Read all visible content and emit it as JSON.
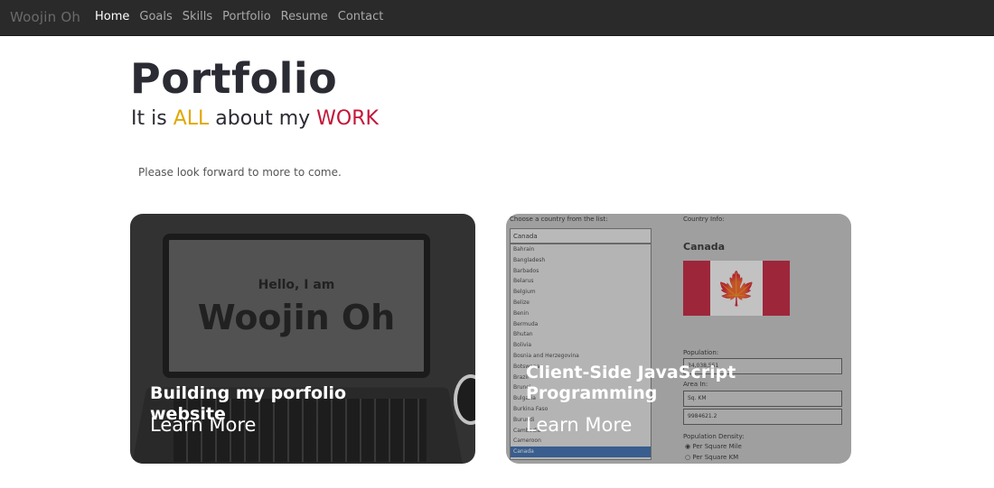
{
  "navbar": {
    "brand": "Woojin Oh",
    "links": [
      "Home",
      "Goals",
      "Skills",
      "Portfolio",
      "Resume",
      "Contact"
    ]
  },
  "header": {
    "title": "Portfolio",
    "tagline_part1": "It is ",
    "tagline_all": "ALL",
    "tagline_part2": " about my ",
    "tagline_work": "WORK",
    "intro": "Please look forward to more to come."
  },
  "cards": [
    {
      "title": "Building my porfolio website",
      "link": "Learn More",
      "screen_hello": "Hello, I am",
      "screen_name": "Woojin Oh"
    },
    {
      "title": "Client-Side JavaScript Programming",
      "link": "Learn More",
      "app": {
        "choose_label": "Choose a country from the list:",
        "selected": "Canada",
        "info_label": "Country Info:",
        "country": "Canada",
        "population_label": "Population:",
        "population_value": "34,038,551",
        "area_label": "Area In:",
        "area_unit": "Sq. KM",
        "area_value": "9984621.2",
        "density_label": "Population Density:",
        "density_opt1": "Per Square Mile",
        "density_opt2": "Per Square KM",
        "countries": [
          "Bahrain",
          "Bangladesh",
          "Barbados",
          "Belarus",
          "Belgium",
          "Belize",
          "Benin",
          "Bermuda",
          "Bhutan",
          "Bolivia",
          "Bosnia and Herzegovina",
          "Botswana",
          "Brazil",
          "Brunei",
          "Bulgaria",
          "Burkina Faso",
          "Burundi",
          "Cambodia",
          "Cameroon",
          "Canada"
        ]
      }
    }
  ],
  "colors": {
    "accent_all": "#e0a800",
    "accent_work": "#c4163a",
    "navbar_bg": "#2a2a2a"
  }
}
